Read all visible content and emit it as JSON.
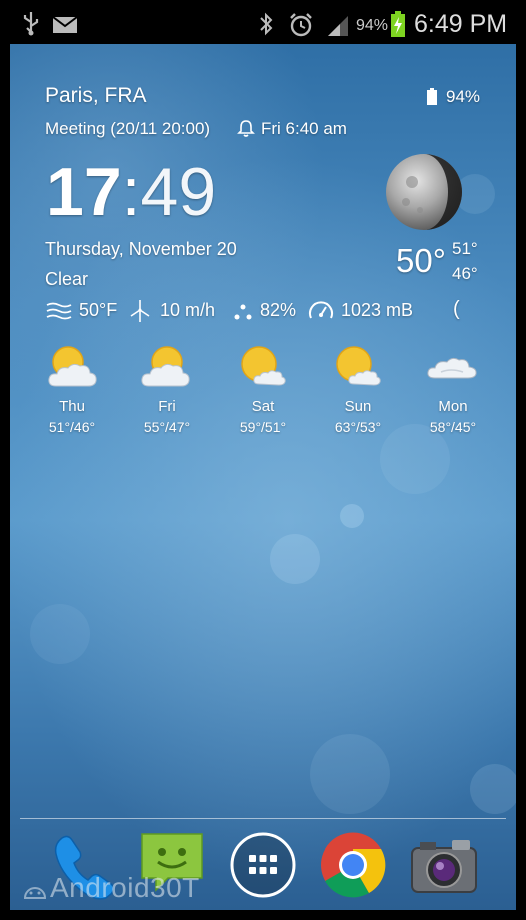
{
  "status_bar": {
    "battery_percent": "94%",
    "time": "6:49 PM",
    "icons": [
      "usb-icon",
      "mail-icon",
      "bluetooth-icon",
      "alarm-icon",
      "signal-icon",
      "battery-charging-icon"
    ]
  },
  "widget": {
    "location": "Paris, FRA",
    "battery": "94%",
    "next_event": "Meeting (20/11 20:00)",
    "alarm": "Fri 6:40 am",
    "time_hours": "17",
    "time_sep": ":",
    "time_minutes": "49",
    "date": "Thursday, November 20",
    "condition": "Clear",
    "current_temp": "50°",
    "high": "51°",
    "low": "46°",
    "details": {
      "feels_like": "50°F",
      "wind": "10 m/h",
      "humidity": "82%",
      "pressure": "1023 mB",
      "extra": "("
    }
  },
  "forecast": [
    {
      "day": "Thu",
      "temps": "51°/46°",
      "icon": "partly-cloudy-icon"
    },
    {
      "day": "Fri",
      "temps": "55°/47°",
      "icon": "partly-cloudy-icon"
    },
    {
      "day": "Sat",
      "temps": "59°/51°",
      "icon": "mostly-sunny-icon"
    },
    {
      "day": "Sun",
      "temps": "63°/53°",
      "icon": "mostly-sunny-icon"
    },
    {
      "day": "Mon",
      "temps": "58°/45°",
      "icon": "cloudy-icon"
    }
  ],
  "dock": [
    "phone-icon",
    "messaging-icon",
    "app-drawer-icon",
    "chrome-icon",
    "camera-icon"
  ],
  "watermark": "Android30T",
  "colors": {
    "accent_yellow": "#f3c530",
    "status_bar_bg": "#000000",
    "battery_green": "#7ed321"
  }
}
